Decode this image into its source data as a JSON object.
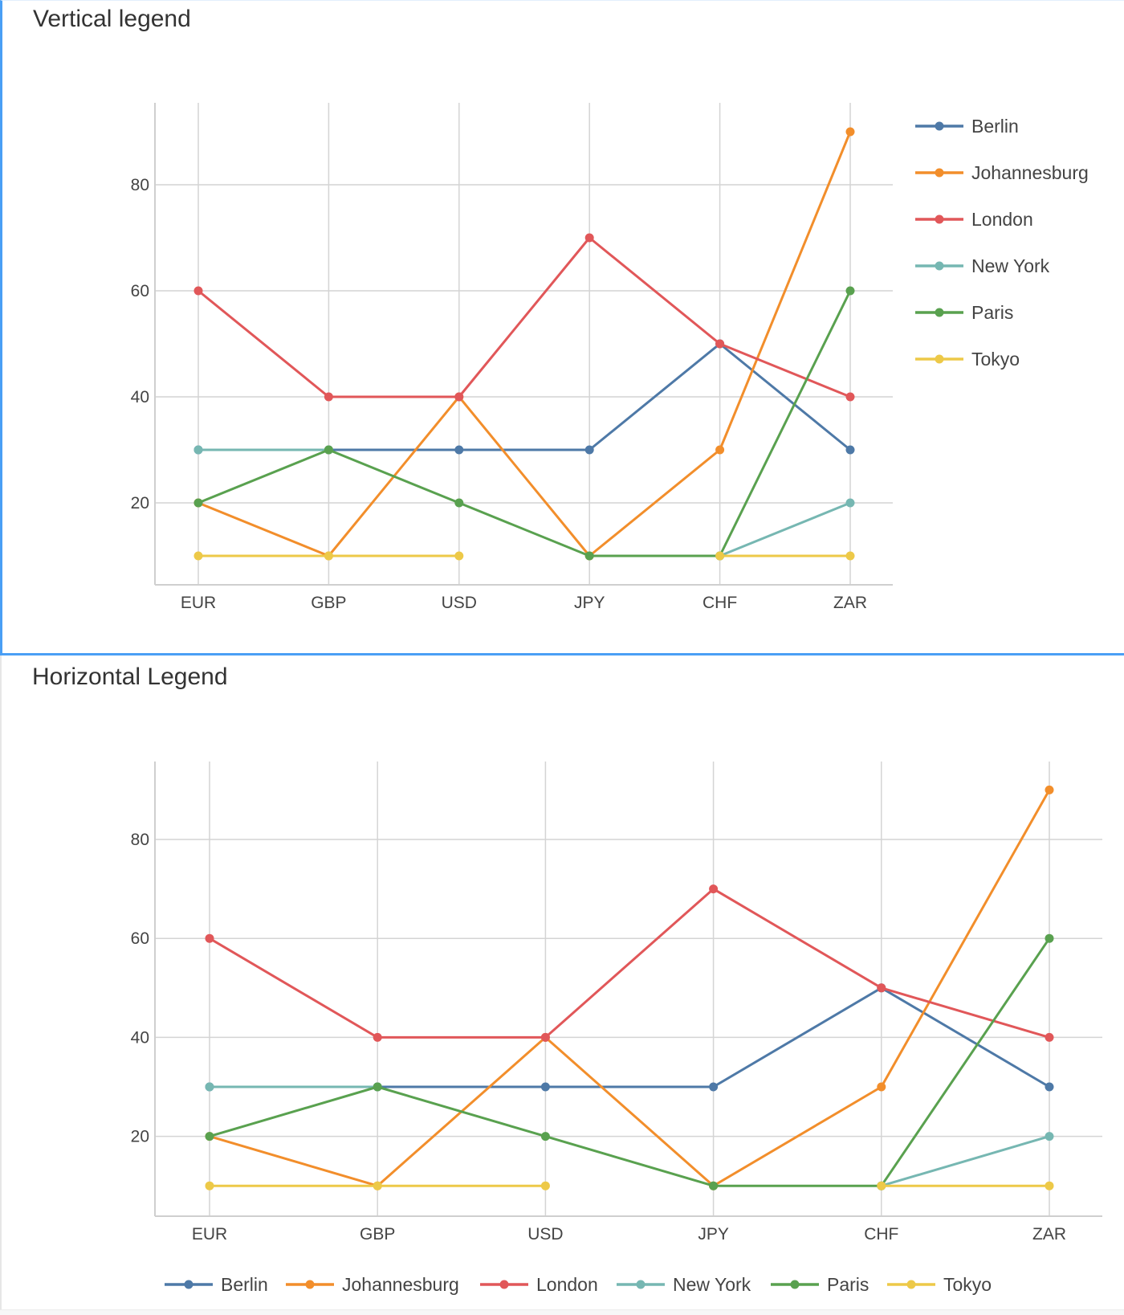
{
  "panels": [
    {
      "title": "Vertical legend",
      "legend_orientation": "vertical",
      "legend_position": "right",
      "focused": true
    },
    {
      "title": "Horizontal Legend",
      "legend_orientation": "horizontal",
      "legend_position": "bottom",
      "focused": false
    }
  ],
  "chart_data": [
    {
      "type": "line",
      "title": "Vertical legend",
      "xlabel": "",
      "ylabel": "",
      "categories": [
        "EUR",
        "GBP",
        "USD",
        "JPY",
        "CHF",
        "ZAR"
      ],
      "yticks": [
        20,
        40,
        60,
        80
      ],
      "ylim": [
        4.5,
        95.5
      ],
      "grid": true,
      "legend": "right",
      "series": [
        {
          "name": "Berlin",
          "color": "#4e79a7",
          "values": [
            30,
            30,
            30,
            30,
            50,
            30
          ]
        },
        {
          "name": "Johannesburg",
          "color": "#f28e2b",
          "values": [
            20,
            10,
            40,
            10,
            30,
            90
          ]
        },
        {
          "name": "London",
          "color": "#e15759",
          "values": [
            60,
            40,
            40,
            70,
            50,
            40
          ]
        },
        {
          "name": "New York",
          "color": "#76b7b2",
          "values": [
            30,
            30,
            null,
            null,
            10,
            20
          ]
        },
        {
          "name": "Paris",
          "color": "#59a14f",
          "values": [
            20,
            30,
            20,
            10,
            10,
            60
          ]
        },
        {
          "name": "Tokyo",
          "color": "#edc948",
          "values": [
            10,
            10,
            10,
            null,
            10,
            10
          ]
        }
      ]
    },
    {
      "type": "line",
      "title": "Horizontal Legend",
      "xlabel": "",
      "ylabel": "",
      "categories": [
        "EUR",
        "GBP",
        "USD",
        "JPY",
        "CHF",
        "ZAR"
      ],
      "yticks": [
        20,
        40,
        60,
        80
      ],
      "ylim": [
        4.5,
        95.5
      ],
      "grid": true,
      "legend": "bottom",
      "series": [
        {
          "name": "Berlin",
          "color": "#4e79a7",
          "values": [
            30,
            30,
            30,
            30,
            50,
            30
          ]
        },
        {
          "name": "Johannesburg",
          "color": "#f28e2b",
          "values": [
            20,
            10,
            40,
            10,
            30,
            90
          ]
        },
        {
          "name": "London",
          "color": "#e15759",
          "values": [
            60,
            40,
            40,
            70,
            50,
            40
          ]
        },
        {
          "name": "New York",
          "color": "#76b7b2",
          "values": [
            30,
            30,
            null,
            null,
            10,
            20
          ]
        },
        {
          "name": "Paris",
          "color": "#59a14f",
          "values": [
            20,
            30,
            20,
            10,
            10,
            60
          ]
        },
        {
          "name": "Tokyo",
          "color": "#edc948",
          "values": [
            10,
            10,
            10,
            null,
            10,
            10
          ]
        }
      ]
    }
  ]
}
